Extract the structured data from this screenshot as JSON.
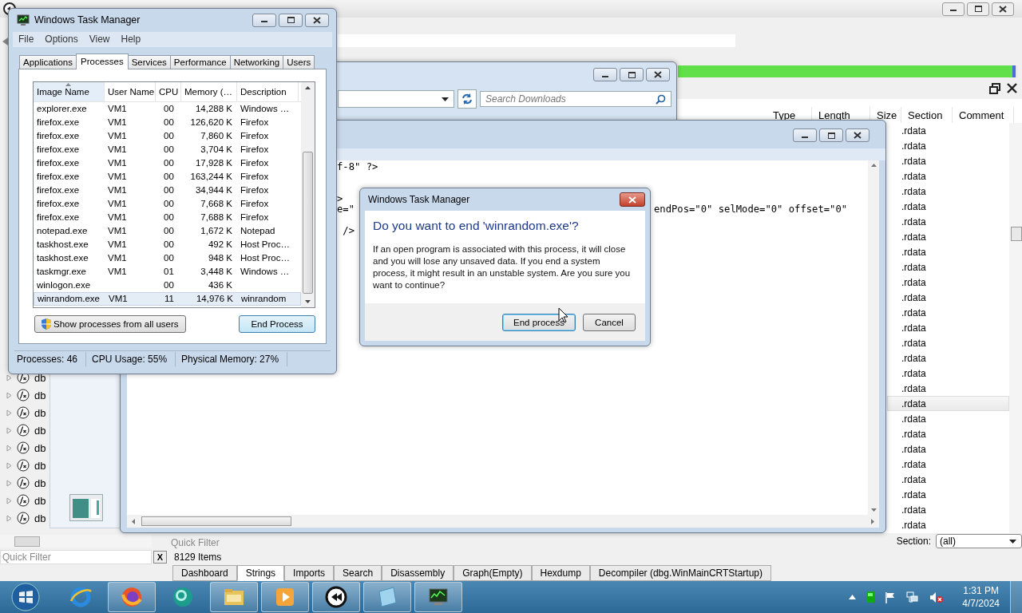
{
  "cutter": {
    "progress": {
      "level": 0.995
    },
    "functions": [
      {
        "name": "db"
      },
      {
        "name": "db"
      },
      {
        "name": "db"
      },
      {
        "name": "db"
      },
      {
        "name": "db"
      },
      {
        "name": "db"
      },
      {
        "name": "db"
      },
      {
        "name": "db"
      },
      {
        "name": "db"
      }
    ],
    "strings": {
      "columns": [
        "Type",
        "Length",
        "Size",
        "Section",
        "Comment"
      ],
      "rows": [
        {
          "section": ".rdata",
          "selected": false
        },
        {
          "section": ".rdata",
          "selected": false
        },
        {
          "section": ".rdata",
          "selected": false
        },
        {
          "section": ".rdata",
          "selected": false
        },
        {
          "section": ".rdata",
          "selected": false
        },
        {
          "section": ".rdata",
          "selected": false
        },
        {
          "section": ".rdata",
          "selected": false
        },
        {
          "section": ".rdata",
          "selected": false
        },
        {
          "section": ".rdata",
          "selected": false
        },
        {
          "section": ".rdata",
          "selected": false
        },
        {
          "section": ".rdata",
          "selected": false
        },
        {
          "section": ".rdata",
          "selected": false
        },
        {
          "section": ".rdata",
          "selected": false
        },
        {
          "section": ".rdata",
          "selected": false
        },
        {
          "section": ".rdata",
          "selected": false
        },
        {
          "section": ".rdata",
          "selected": false
        },
        {
          "section": ".rdata",
          "selected": false
        },
        {
          "section": ".rdata",
          "selected": false
        },
        {
          "section": ".rdata",
          "selected": true
        },
        {
          "section": ".rdata",
          "selected": false
        },
        {
          "section": ".rdata",
          "selected": false
        },
        {
          "section": ".rdata",
          "selected": false
        },
        {
          "section": ".rdata",
          "selected": false
        },
        {
          "section": ".rdata",
          "selected": false
        },
        {
          "section": ".rdata",
          "selected": false
        },
        {
          "section": ".rdata",
          "selected": false
        },
        {
          "section": ".rdata",
          "selected": false
        }
      ]
    },
    "strings_filter": {
      "placeholder": "Quick Filter"
    },
    "left_filter": {
      "placeholder": "Quick Filter"
    },
    "clear_button": "X",
    "item_count": "8129 Items",
    "section_filter": {
      "label": "Section:",
      "value": "(all)"
    },
    "tabs": [
      {
        "label": "Dashboard",
        "selected": false
      },
      {
        "label": "Strings",
        "selected": true
      },
      {
        "label": "Imports",
        "selected": false
      },
      {
        "label": "Search",
        "selected": false
      },
      {
        "label": "Disassembly",
        "selected": false
      },
      {
        "label": "Graph(Empty)",
        "selected": false
      },
      {
        "label": "Hexdump",
        "selected": false
      },
      {
        "label": "Decompiler (dbg.WinMainCRTStartup)",
        "selected": false
      }
    ]
  },
  "explorer": {
    "search": {
      "placeholder": "Search Downloads"
    }
  },
  "editor": {
    "text_left": "f-8\" ?>\n\n\n>\ne=\"\n\n /> ",
    "text_right": "endPos=\"0\" selMode=\"0\" offset=\"0\""
  },
  "task_manager": {
    "title": "Windows Task Manager",
    "menu": [
      "File",
      "Options",
      "View",
      "Help"
    ],
    "tabs": [
      {
        "label": "Applications",
        "selected": false
      },
      {
        "label": "Processes",
        "selected": true
      },
      {
        "label": "Services",
        "selected": false
      },
      {
        "label": "Performance",
        "selected": false
      },
      {
        "label": "Networking",
        "selected": false
      },
      {
        "label": "Users",
        "selected": false
      }
    ],
    "columns": [
      "Image Name",
      "User Name",
      "CPU",
      "Memory (…",
      "Description"
    ],
    "rows": [
      {
        "image": "explorer.exe",
        "user": "VM1",
        "cpu": "00",
        "memory": "14,288 K",
        "description": "Windows …",
        "selected": false
      },
      {
        "image": "firefox.exe",
        "user": "VM1",
        "cpu": "00",
        "memory": "126,620 K",
        "description": "Firefox",
        "selected": false
      },
      {
        "image": "firefox.exe",
        "user": "VM1",
        "cpu": "00",
        "memory": "7,860 K",
        "description": "Firefox",
        "selected": false
      },
      {
        "image": "firefox.exe",
        "user": "VM1",
        "cpu": "00",
        "memory": "3,704 K",
        "description": "Firefox",
        "selected": false
      },
      {
        "image": "firefox.exe",
        "user": "VM1",
        "cpu": "00",
        "memory": "17,928 K",
        "description": "Firefox",
        "selected": false
      },
      {
        "image": "firefox.exe",
        "user": "VM1",
        "cpu": "00",
        "memory": "163,244 K",
        "description": "Firefox",
        "selected": false
      },
      {
        "image": "firefox.exe",
        "user": "VM1",
        "cpu": "00",
        "memory": "34,944 K",
        "description": "Firefox",
        "selected": false
      },
      {
        "image": "firefox.exe",
        "user": "VM1",
        "cpu": "00",
        "memory": "7,668 K",
        "description": "Firefox",
        "selected": false
      },
      {
        "image": "firefox.exe",
        "user": "VM1",
        "cpu": "00",
        "memory": "7,688 K",
        "description": "Firefox",
        "selected": false
      },
      {
        "image": "notepad.exe",
        "user": "VM1",
        "cpu": "00",
        "memory": "1,672 K",
        "description": "Notepad",
        "selected": false
      },
      {
        "image": "taskhost.exe",
        "user": "VM1",
        "cpu": "00",
        "memory": "492 K",
        "description": "Host Proc…",
        "selected": false
      },
      {
        "image": "taskhost.exe",
        "user": "VM1",
        "cpu": "00",
        "memory": "948 K",
        "description": "Host Proc…",
        "selected": false
      },
      {
        "image": "taskmgr.exe",
        "user": "VM1",
        "cpu": "01",
        "memory": "3,448 K",
        "description": "Windows …",
        "selected": false
      },
      {
        "image": "winlogon.exe",
        "cpu": "00",
        "memory": "436 K",
        "selected": false
      },
      {
        "image": "winrandom.exe",
        "user": "VM1",
        "cpu": "11",
        "memory": "14,976 K",
        "description": "winrandom",
        "selected": true
      }
    ],
    "show_all_button": "Show processes from all users",
    "end_button": "End Process",
    "status": [
      "Processes: 46",
      "CPU Usage: 55%",
      "Physical Memory: 27%"
    ]
  },
  "dialog": {
    "title": "Windows Task Manager",
    "heading": "Do you want to end 'winrandom.exe'?",
    "body": "If an open program is associated with this process, it will close and you will lose any unsaved data. If you end a system process, it might result in an unstable system. Are you sure you want to continue?",
    "buttons": [
      {
        "label": "End process",
        "default": true
      },
      {
        "label": "Cancel",
        "default": false
      }
    ]
  },
  "taskbar": {
    "apps": [
      {
        "kind": "ie",
        "running": false
      },
      {
        "kind": "firefox",
        "running": true
      },
      {
        "kind": "orb",
        "running": false
      },
      {
        "kind": "folder",
        "running": true
      },
      {
        "kind": "media",
        "running": true
      },
      {
        "kind": "cutter",
        "running": true
      },
      {
        "kind": "notepad",
        "running": true
      },
      {
        "kind": "taskmgr",
        "running": true
      }
    ],
    "time": "1:31 PM",
    "date": "4/7/2024"
  }
}
